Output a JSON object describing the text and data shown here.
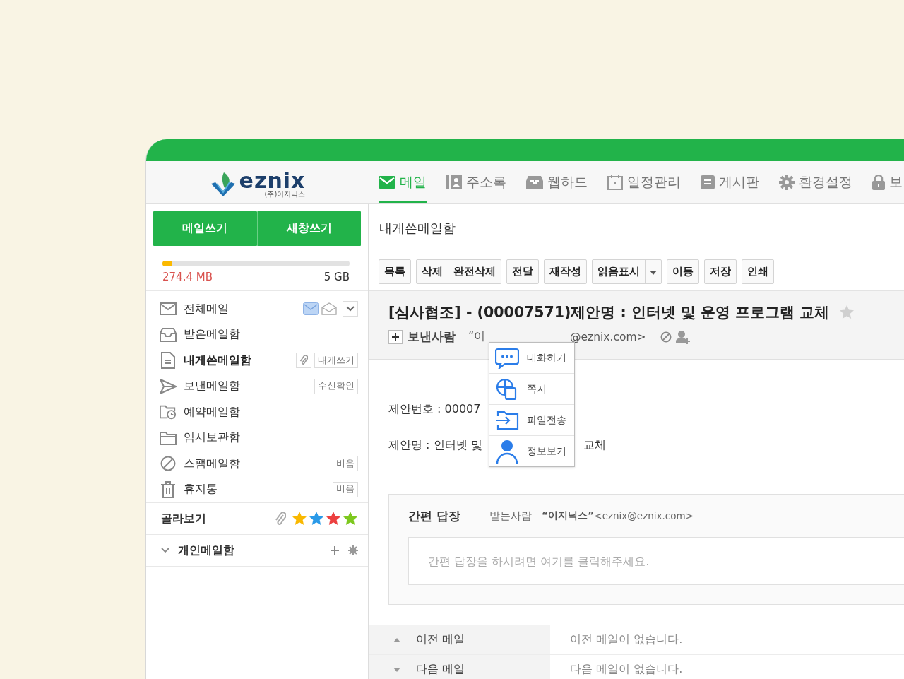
{
  "logo": {
    "name": "eznix",
    "subtitle": "(주)이지닉스"
  },
  "nav": [
    {
      "kind": "mail",
      "label": "메일",
      "selected": true
    },
    {
      "kind": "contacts",
      "label": "주소록",
      "selected": false
    },
    {
      "kind": "drive",
      "label": "웹하드",
      "selected": false
    },
    {
      "kind": "calendar",
      "label": "일정관리",
      "selected": false
    },
    {
      "kind": "board",
      "label": "게시판",
      "selected": false
    },
    {
      "kind": "settings",
      "label": "환경설정",
      "selected": false
    },
    {
      "kind": "lock",
      "label": "보",
      "selected": false
    }
  ],
  "compose_buttons": [
    "메일쓰기",
    "새창쓰기"
  ],
  "storage": {
    "used": "274.4 MB",
    "total": "5 GB",
    "level": 0.04
  },
  "folders": [
    {
      "kind": "all",
      "label": "전체메일",
      "selected": false,
      "actions": [
        {
          "kind": "unread"
        },
        {
          "kind": "read"
        },
        {
          "kind": "more"
        }
      ]
    },
    {
      "kind": "inbox",
      "label": "받은메일함",
      "selected": false
    },
    {
      "kind": "self",
      "label": "내게쓴메일함",
      "selected": true,
      "actions": [
        {
          "kind": "attach"
        },
        {
          "kind": "text",
          "label": "내게쓰기"
        }
      ]
    },
    {
      "kind": "sent",
      "label": "보낸메일함",
      "selected": false,
      "actions": [
        {
          "kind": "text",
          "label": "수신확인"
        }
      ]
    },
    {
      "kind": "reserved",
      "label": "예약메일함",
      "selected": false
    },
    {
      "kind": "temp",
      "label": "임시보관함",
      "selected": false
    },
    {
      "kind": "spam",
      "label": "스팸메일함",
      "selected": false,
      "actions": [
        {
          "kind": "text",
          "label": "비움"
        }
      ]
    },
    {
      "kind": "trash",
      "label": "휴지통",
      "selected": false,
      "actions": [
        {
          "kind": "text",
          "label": "비움"
        }
      ]
    }
  ],
  "filter": {
    "label": "골라보기",
    "items": [
      {
        "kind": "attach"
      },
      {
        "kind": "star",
        "color": "#f9b800"
      },
      {
        "kind": "star",
        "color": "#2a9ae8"
      },
      {
        "kind": "star",
        "color": "#ec4040"
      },
      {
        "kind": "star",
        "color": "#7dc81e"
      }
    ]
  },
  "personal": {
    "label": "개인메일함",
    "expanded": true
  },
  "folder_title": "내게쓴메일함",
  "toolbar": [
    {
      "buttons": [
        "목록"
      ],
      "dropdown": false
    },
    {
      "buttons": [
        "삭제",
        "완전삭제"
      ],
      "dropdown": false
    },
    {
      "buttons": [
        "전달"
      ],
      "dropdown": false
    },
    {
      "buttons": [
        "재작성"
      ],
      "dropdown": false
    },
    {
      "buttons": [
        "읽음표시"
      ],
      "dropdown": true
    },
    {
      "buttons": [
        "이동"
      ],
      "dropdown": false
    },
    {
      "buttons": [
        "저장"
      ],
      "dropdown": false
    },
    {
      "buttons": [
        "인쇄"
      ],
      "dropdown": false
    }
  ],
  "message": {
    "subject": "[심사협조] - (00007571)제안명 : 인터넷 및 운영 프로그램 교체",
    "starred": false,
    "sender_label": "보낸사람",
    "sender_parts": [
      "“이",
      "@eznix.com>"
    ],
    "body": [
      [
        "제안번호 : 00007"
      ],
      [
        "제안명 : 인터넷 및",
        "교체"
      ]
    ]
  },
  "popup": [
    {
      "kind": "chat",
      "label": "대화하기"
    },
    {
      "kind": "note",
      "label": "쪽지"
    },
    {
      "kind": "file",
      "label": "파일전송"
    },
    {
      "kind": "profile",
      "label": "정보보기"
    }
  ],
  "quick_reply": {
    "title": "간편 답장",
    "recipient_label": "받는사람",
    "recipient_name": "“이지닉스”",
    "recipient_email": "<eznix@eznix.com>",
    "placeholder": "간편 답장을 하시려면 여기를 클릭해주세요."
  },
  "nav_rows": [
    {
      "kind": "prev",
      "label": "이전 메일",
      "text": "이전 메일이 없습니다."
    },
    {
      "kind": "next",
      "label": "다음 메일",
      "text": "다음 메일이 없습니다."
    }
  ]
}
